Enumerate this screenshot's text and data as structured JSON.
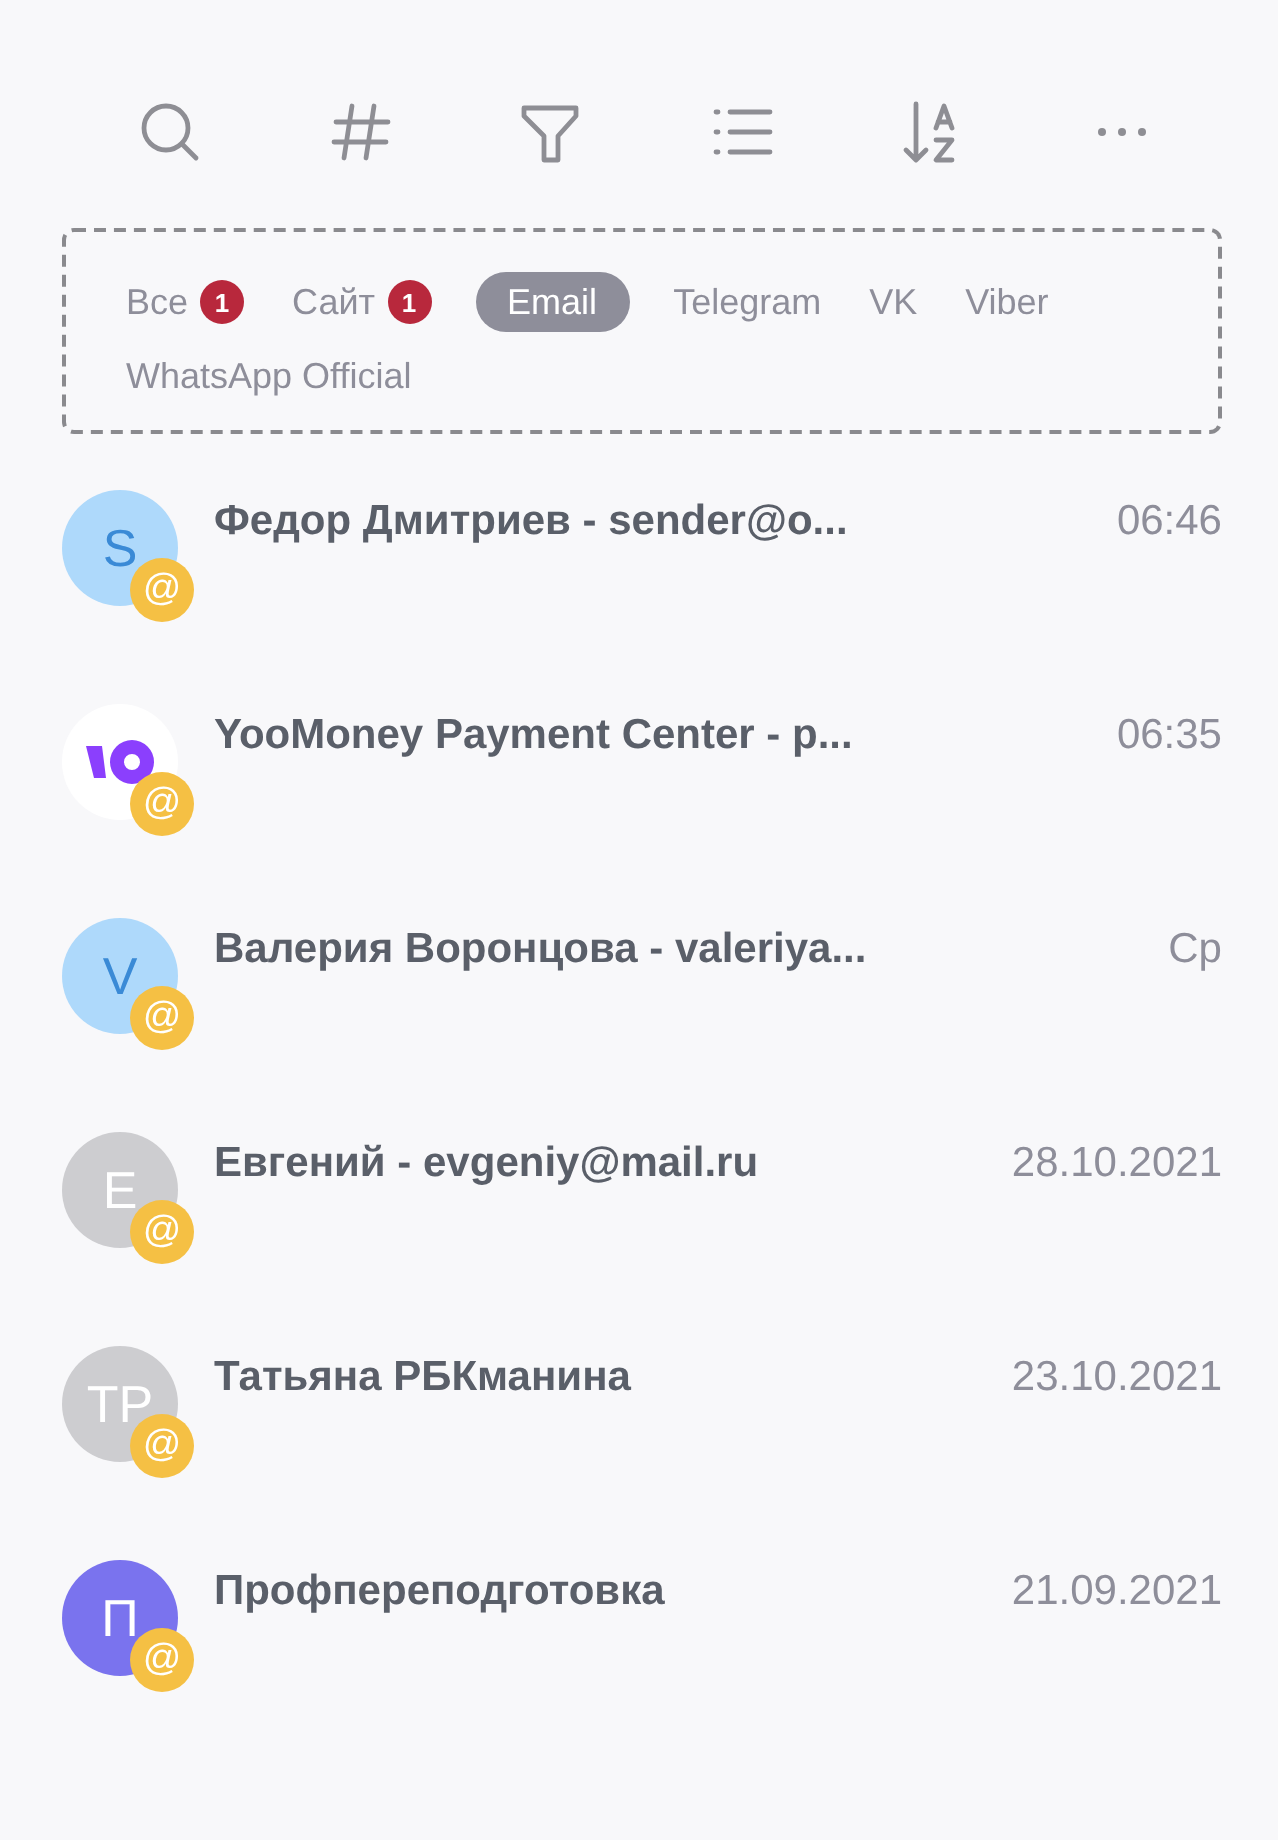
{
  "toolbar": [
    {
      "kind": "search"
    },
    {
      "kind": "hash"
    },
    {
      "kind": "filter"
    },
    {
      "kind": "list"
    },
    {
      "kind": "sort"
    },
    {
      "kind": "more"
    }
  ],
  "channels": [
    {
      "label": "Все",
      "count": "1",
      "selected": false
    },
    {
      "label": "Сайт",
      "count": "1",
      "selected": false
    },
    {
      "label": "Email",
      "selected": true
    },
    {
      "label": "Telegram",
      "selected": false
    },
    {
      "label": "VK",
      "selected": false
    },
    {
      "label": "Viber",
      "selected": false
    },
    {
      "label": "WhatsApp Official",
      "selected": false
    }
  ],
  "chats": [
    {
      "avatar": {
        "kind": "initials",
        "text": "S",
        "color": "#aed9fb"
      },
      "badge": "@",
      "title": "Федор Дмитриев - sender@o...",
      "time": "06:46"
    },
    {
      "avatar": {
        "kind": "logo",
        "color": "#ffffff"
      },
      "badge": "@",
      "title": "YooMoney Payment Center - p...",
      "time": "06:35"
    },
    {
      "avatar": {
        "kind": "initials",
        "text": "V",
        "color": "#aed9fb"
      },
      "badge": "@",
      "title": "Валерия Воронцова - valeriya...",
      "time": "Ср"
    },
    {
      "avatar": {
        "kind": "initials",
        "text": "E",
        "color": "#cdcdd0"
      },
      "badge": "@",
      "title": "Евгений - evgeniy@mail.ru",
      "time": "28.10.2021"
    },
    {
      "avatar": {
        "kind": "initials",
        "text": "TP",
        "color": "#cdcdd0"
      },
      "badge": "@",
      "title": "Татьяна РБКманина",
      "time": "23.10.2021"
    },
    {
      "avatar": {
        "kind": "initials",
        "text": "П",
        "color": "#7a73ee"
      },
      "badge": "@",
      "title": "Профпереподготовка",
      "time": "21.09.2021"
    }
  ]
}
